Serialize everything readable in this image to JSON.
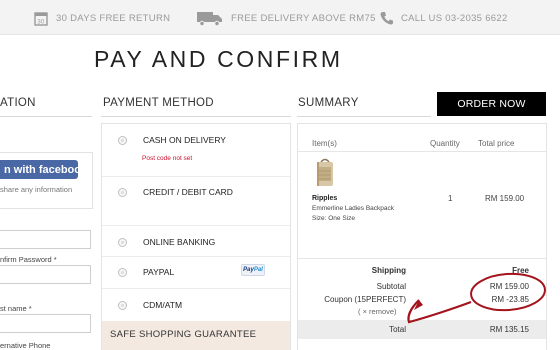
{
  "topbar": {
    "perks": [
      {
        "icon": "calendar-icon",
        "label": "30 DAYS FREE RETURN"
      },
      {
        "icon": "truck-icon",
        "label": "FREE DELIVERY ABOVE RM75"
      },
      {
        "icon": "phone-icon",
        "label": "CALL US 03-2035 6622"
      }
    ]
  },
  "page": {
    "title": "PAY AND CONFIRM"
  },
  "columns": {
    "information": "ATION",
    "payment": "PAYMENT METHOD",
    "summary": "SUMMARY"
  },
  "order_now_label": "ORDER NOW",
  "left": {
    "facebook_label": "n with facebook",
    "facebook_note": "share any information",
    "confirm_password_label": "nfirm Password *",
    "last_name_label": "st name *",
    "alt_phone_label": "ernative Phone"
  },
  "payment": {
    "options": [
      {
        "label": "CASH ON DELIVERY"
      },
      {
        "label": "CREDIT / DEBIT CARD"
      },
      {
        "label": "ONLINE BANKING"
      },
      {
        "label": "PAYPAL"
      },
      {
        "label": "CDM/ATM"
      }
    ],
    "error": "Post code not set",
    "paypal_badge": [
      "Pay",
      "Pal"
    ],
    "guarantee": "SAFE SHOPPING GUARANTEE"
  },
  "summary": {
    "headers": {
      "items": "Item(s)",
      "quantity": "Quantity",
      "total_price": "Total price"
    },
    "product": {
      "name": "Ripples",
      "description": "Emmerline Ladies Backpack",
      "size": "Size: One Size",
      "quantity": "1",
      "price": "RM 159.00"
    },
    "shipping_label": "Shipping",
    "shipping_value": "Free",
    "subtotal_label": "Subtotal",
    "subtotal_value": "RM 159.00",
    "coupon_label": "Coupon (15PERFECT)",
    "coupon_value": "RM -23.85",
    "remove_label": "( ×  remove)",
    "total_label": "Total",
    "total_value": "RM 135.15"
  },
  "colors": {
    "accent": "#000000",
    "annotation": "#a3141c",
    "error": "#c8102e",
    "guarantee_bg": "#f4e9e1"
  }
}
